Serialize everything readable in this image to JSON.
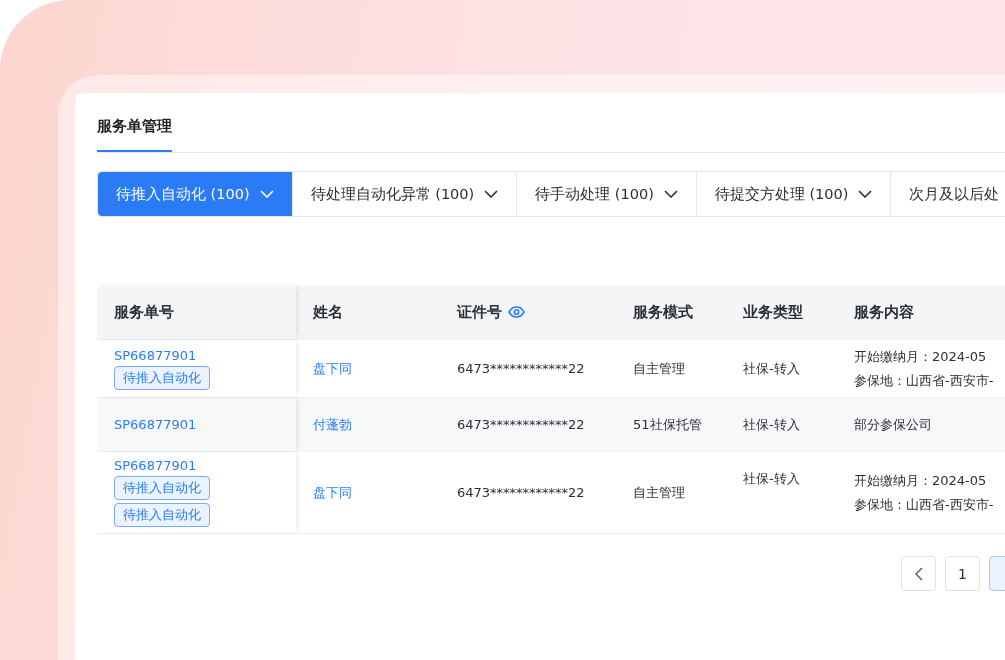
{
  "page": {
    "title": "服务单管理"
  },
  "tabs": [
    {
      "label": "待推入自动化 (100)",
      "selected": true,
      "caret": true
    },
    {
      "label": "待处理自动化异常 (100)",
      "selected": false,
      "caret": true
    },
    {
      "label": "待手动处理 (100)",
      "selected": false,
      "caret": true
    },
    {
      "label": "待提交方处理 (100)",
      "selected": false,
      "caret": true
    },
    {
      "label": "次月及以后处",
      "selected": false,
      "caret": false
    }
  ],
  "table": {
    "columns": [
      {
        "label": "服务单号",
        "eye": false
      },
      {
        "label": "姓名",
        "eye": false
      },
      {
        "label": "证件号",
        "eye": true
      },
      {
        "label": "服务模式",
        "eye": false
      },
      {
        "label": "业务类型",
        "eye": false
      },
      {
        "label": "服务内容",
        "eye": false
      }
    ],
    "rows": [
      {
        "order_no": "SP66877901",
        "tags": [
          "待推入自动化"
        ],
        "name": "盘下同",
        "id_no": "6473************22",
        "mode": "自主管理",
        "type": "社保-转入",
        "content": [
          "开始缴纳月：2024-05",
          "参保地：山西省-西安市-"
        ]
      },
      {
        "order_no": "SP66877901",
        "tags": [],
        "name": "付蓬勃",
        "id_no": "6473************22",
        "mode": "51社保托管",
        "type": "社保-转入",
        "content": [
          "部分参保公司"
        ]
      },
      {
        "order_no": "SP66877901",
        "tags": [
          "待推入自动化",
          "待推入自动化"
        ],
        "name": "盘下同",
        "id_no": "6473************22",
        "mode": "自主管理",
        "type": "社保-转入",
        "content": [
          "开始缴纳月：2024-05",
          "参保地：山西省-西安市-"
        ]
      }
    ]
  },
  "pagination": {
    "pages": [
      {
        "label": "1",
        "selected": false
      }
    ]
  }
}
